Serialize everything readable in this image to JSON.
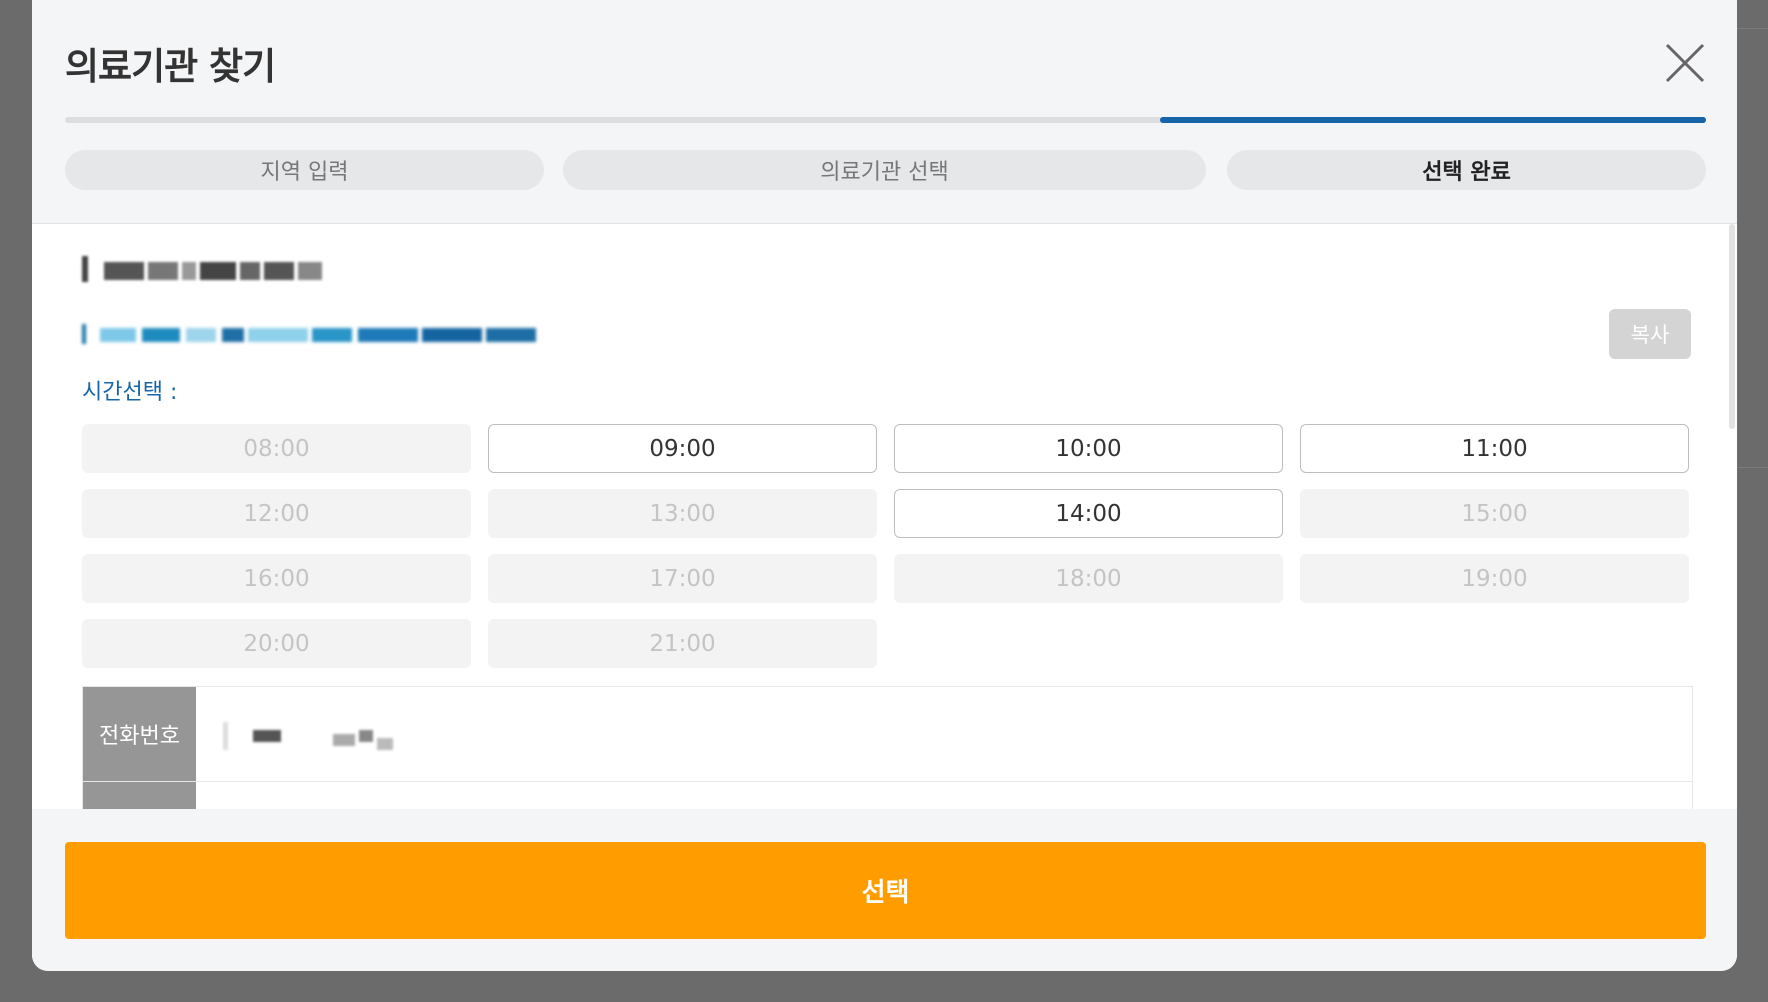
{
  "modal": {
    "title": "의료기관 찾기",
    "progress_fraction": 0.333,
    "steps": [
      {
        "label": "지역 입력",
        "active": false
      },
      {
        "label": "의료기관 선택",
        "active": false
      },
      {
        "label": "선택 완료",
        "active": true
      }
    ]
  },
  "details": {
    "copy_label": "복사",
    "time_label": "시간선택 :"
  },
  "time_slots": [
    {
      "time": "08:00",
      "enabled": false
    },
    {
      "time": "09:00",
      "enabled": true
    },
    {
      "time": "10:00",
      "enabled": true
    },
    {
      "time": "11:00",
      "enabled": true
    },
    {
      "time": "12:00",
      "enabled": false
    },
    {
      "time": "13:00",
      "enabled": false
    },
    {
      "time": "14:00",
      "enabled": true
    },
    {
      "time": "15:00",
      "enabled": false
    },
    {
      "time": "16:00",
      "enabled": false
    },
    {
      "time": "17:00",
      "enabled": false
    },
    {
      "time": "18:00",
      "enabled": false
    },
    {
      "time": "19:00",
      "enabled": false
    },
    {
      "time": "20:00",
      "enabled": false
    },
    {
      "time": "21:00",
      "enabled": false
    }
  ],
  "info": {
    "phone_label": "전화번호"
  },
  "footer": {
    "select_label": "선택"
  },
  "colors": {
    "accent": "#1565a8",
    "primary_button": "#ff9d00",
    "disabled_slot": "#f3f3f3"
  }
}
